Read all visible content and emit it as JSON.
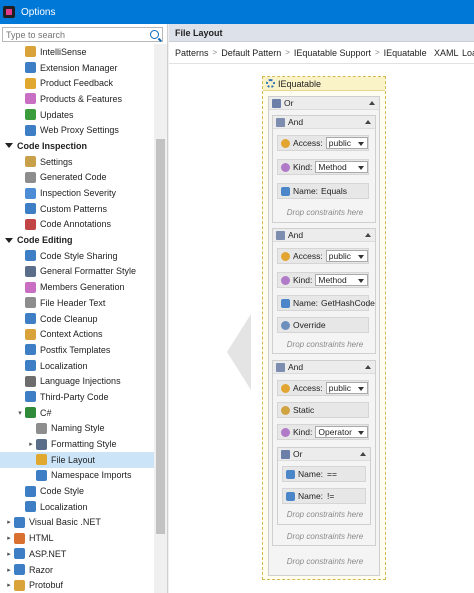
{
  "window": {
    "title": "Options"
  },
  "search": {
    "placeholder": "Type to search"
  },
  "tree": [
    {
      "label": "IntelliSense",
      "indent": 1,
      "color": "#d9a33a"
    },
    {
      "label": "Extension Manager",
      "indent": 1,
      "color": "#3d7ec4"
    },
    {
      "label": "Product Feedback",
      "indent": 1,
      "color": "#e0a82f"
    },
    {
      "label": "Products & Features",
      "indent": 1,
      "color": "#c86fc4"
    },
    {
      "label": "Updates",
      "indent": 1,
      "color": "#3a9c3c"
    },
    {
      "label": "Web Proxy Settings",
      "indent": 1,
      "color": "#3d7ec4"
    },
    {
      "label": "Code Inspection",
      "indent": 0,
      "group": true
    },
    {
      "label": "Settings",
      "indent": 1,
      "color": "#c9a04a"
    },
    {
      "label": "Generated Code",
      "indent": 1,
      "color": "#8d8d8d"
    },
    {
      "label": "Inspection Severity",
      "indent": 1,
      "color": "#4d8dd6"
    },
    {
      "label": "Custom Patterns",
      "indent": 1,
      "color": "#3d7ec4"
    },
    {
      "label": "Code Annotations",
      "indent": 1,
      "color": "#c14545"
    },
    {
      "label": "Code Editing",
      "indent": 0,
      "group": true
    },
    {
      "label": "Code Style Sharing",
      "indent": 1,
      "color": "#3d7ec4"
    },
    {
      "label": "General Formatter Style",
      "indent": 1,
      "color": "#5a6e8a"
    },
    {
      "label": "Members Generation",
      "indent": 1,
      "color": "#c86fc4"
    },
    {
      "label": "File Header Text",
      "indent": 1,
      "color": "#8d8d8d"
    },
    {
      "label": "Code Cleanup",
      "indent": 1,
      "color": "#3d7ec4"
    },
    {
      "label": "Context Actions",
      "indent": 1,
      "color": "#d9a33a"
    },
    {
      "label": "Postfix Templates",
      "indent": 1,
      "color": "#3d7ec4"
    },
    {
      "label": "Localization",
      "indent": 1,
      "color": "#3d7ec4"
    },
    {
      "label": "Language Injections",
      "indent": 1,
      "color": "#6d6d6d"
    },
    {
      "label": "Third-Party Code",
      "indent": 1,
      "color": "#3d7ec4"
    },
    {
      "label": "C#",
      "indent": 1,
      "caret": "▾",
      "color": "#2f8a3a"
    },
    {
      "label": "Naming Style",
      "indent": 2,
      "color": "#8d8d8d"
    },
    {
      "label": "Formatting Style",
      "indent": 2,
      "caret": "▸",
      "color": "#5a6e8a"
    },
    {
      "label": "File Layout",
      "indent": 2,
      "color": "#e0a82f",
      "selected": true
    },
    {
      "label": "Namespace Imports",
      "indent": 2,
      "color": "#3d7ec4"
    },
    {
      "label": "Code Style",
      "indent": 1,
      "color": "#3d7ec4"
    },
    {
      "label": "Localization",
      "indent": 1,
      "color": "#3d7ec4"
    },
    {
      "label": "Visual Basic .NET",
      "indent": 0,
      "caret": "▸",
      "color": "#3d7ec4"
    },
    {
      "label": "HTML",
      "indent": 0,
      "caret": "▸",
      "color": "#d9702f"
    },
    {
      "label": "ASP.NET",
      "indent": 0,
      "caret": "▸",
      "color": "#3d7ec4"
    },
    {
      "label": "Razor",
      "indent": 0,
      "caret": "▸",
      "color": "#3d7ec4"
    },
    {
      "label": "Protobuf",
      "indent": 0,
      "caret": "▸",
      "color": "#d9a33a"
    }
  ],
  "panel": {
    "title": "File Layout",
    "breadcrumbs": [
      "Patterns",
      "Default Pattern",
      "IEquatable Support",
      "IEquatable"
    ],
    "tab_xaml": "XAML",
    "tab_loa": "Loa"
  },
  "root": {
    "label": "IEquatable"
  },
  "or": {
    "label": "Or"
  },
  "and1": {
    "label": "And",
    "access_label": "Access:",
    "access_value": "public",
    "kind_label": "Kind:",
    "kind_value": "Method",
    "name_label": "Name:",
    "name_value": "Equals",
    "drop": "Drop constraints here"
  },
  "and2": {
    "label": "And",
    "access_label": "Access:",
    "access_value": "public",
    "kind_label": "Kind:",
    "kind_value": "Method",
    "name_label": "Name:",
    "name_value": "GetHashCode",
    "override": "Override",
    "drop": "Drop constraints here"
  },
  "and3": {
    "label": "And",
    "access_label": "Access:",
    "access_value": "public",
    "static": "Static",
    "kind_label": "Kind:",
    "kind_value": "Operator",
    "or_label": "Or",
    "name_label_a": "Name:",
    "name_value_a": "==",
    "name_label_b": "Name:",
    "name_value_b": "!=",
    "drop_inner": "Drop constraints here",
    "drop": "Drop constraints here"
  },
  "drop_or": "Drop constraints here"
}
